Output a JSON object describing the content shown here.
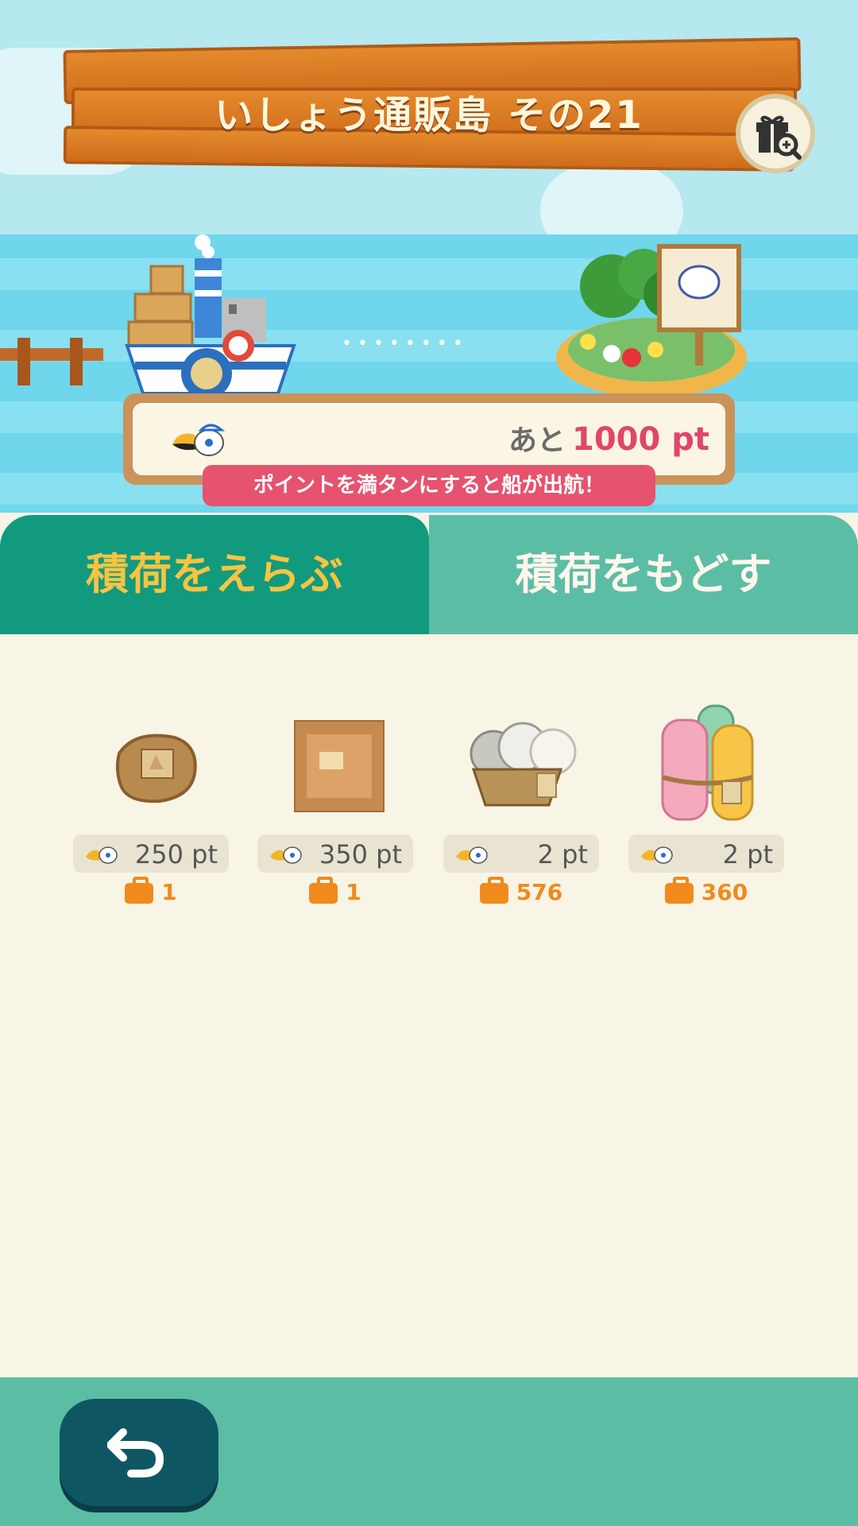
{
  "header": {
    "title": "いしょう通販島 その21"
  },
  "voyage": {
    "remaining_prefix": "あと",
    "remaining_points": "1000 pt",
    "hint": "ポイントを満タンにすると船が出航！",
    "progress_fraction": 0.0
  },
  "tabs": [
    {
      "label": "積荷をえらぶ",
      "selected": true
    },
    {
      "label": "積荷をもどす",
      "selected": false
    }
  ],
  "cargo": [
    {
      "icon": "burlap-sack-icon",
      "points": "250 pt",
      "stock": "1"
    },
    {
      "icon": "wooden-crate-icon",
      "points": "350 pt",
      "stock": "1"
    },
    {
      "icon": "yarn-basket-icon",
      "points": "2 pt",
      "stock": "576"
    },
    {
      "icon": "fabric-rolls-icon",
      "points": "2 pt",
      "stock": "360"
    }
  ],
  "colors": {
    "accent_pink": "#e0466a",
    "tab_selected": "#129a7e",
    "tab_unselected": "#5cbda5",
    "stock_orange": "#f08a1d"
  }
}
